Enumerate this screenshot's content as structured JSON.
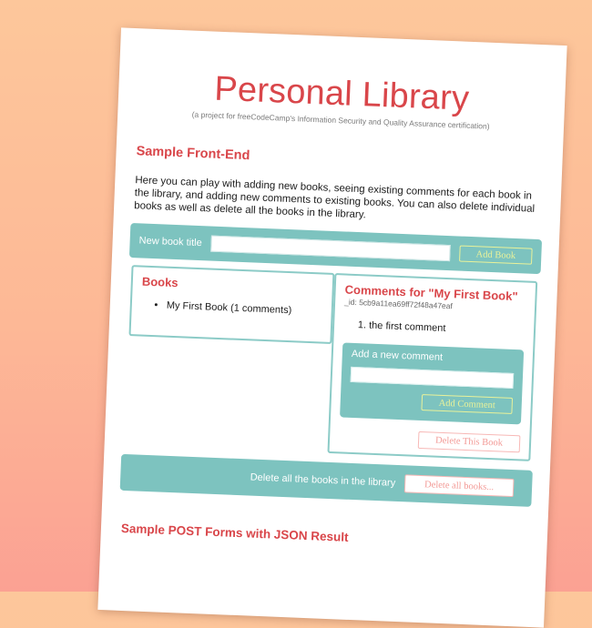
{
  "header": {
    "title": "Personal Library",
    "subtitle": "(a project for freeCodeCamp's Information Security and Quality Assurance certification)"
  },
  "frontend": {
    "heading": "Sample Front-End",
    "intro": "Here you can play with adding new books, seeing existing comments for each book in the library, and adding new comments to existing books. You can also delete individual books as well as delete all the books in the library."
  },
  "add_book": {
    "label": "New book title",
    "value": "",
    "button": "Add Book"
  },
  "books": {
    "heading": "Books",
    "items": [
      "My First Book (1 comments)"
    ]
  },
  "comments": {
    "heading": "Comments for \"My First Book\"",
    "id_text": "_id: 5cb9a11ea69ff72f48a47eaf",
    "items": [
      "the first comment"
    ],
    "form_label": "Add a new comment",
    "form_value": "",
    "add_button": "Add Comment",
    "delete_button": "Delete This Book"
  },
  "delete_all": {
    "label": "Delete all the books in the library",
    "button": "Delete all books..."
  },
  "post_forms": {
    "heading": "Sample POST Forms with JSON Result"
  },
  "colors": {
    "accent_red": "#d9464a",
    "teal": "#7dc3bf",
    "button_yellow": "#e9f29a",
    "delete_pink": "#f39a96"
  }
}
